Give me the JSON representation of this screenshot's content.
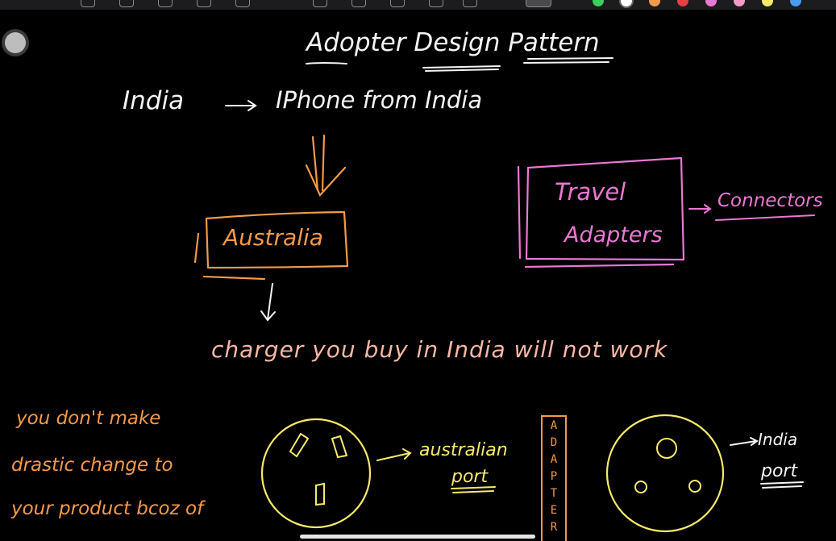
{
  "diagram": {
    "title": "Adopter Design Pattern",
    "line1": {
      "left": "India",
      "right": "IPhone from India"
    },
    "australia_box": "Australia",
    "connector_label": "Connectors",
    "travel_box": {
      "line1": "Travel",
      "line2": "Adapters"
    },
    "charger_note": "charger you buy in India will not work",
    "side_note": {
      "line1": "you don't make",
      "line2": "drastic change to",
      "line3": "your product bcoz of"
    },
    "australian_label": {
      "line1": "australian",
      "line2": "port"
    },
    "adapter_letters": [
      "A",
      "D",
      "A",
      "P",
      "T",
      "E",
      "R"
    ],
    "india_label": {
      "line1": "India",
      "line2": "port"
    }
  },
  "colors": {
    "background": "#000000",
    "white_ink": "#f4f4f4",
    "orange_ink": "#f39a4a",
    "pink_ink": "#e978d3",
    "salmon_ink": "#f6b8a4",
    "yellow_ink": "#f7e96b"
  },
  "icons": {
    "toolbar": [
      "lasso-icon",
      "pen-icon",
      "highlighter-icon",
      "eraser-icon",
      "shape-icon",
      "image-icon",
      "text-icon"
    ],
    "palette": [
      "green",
      "white",
      "orange",
      "red",
      "pink",
      "pink",
      "yellow",
      "blue"
    ]
  }
}
